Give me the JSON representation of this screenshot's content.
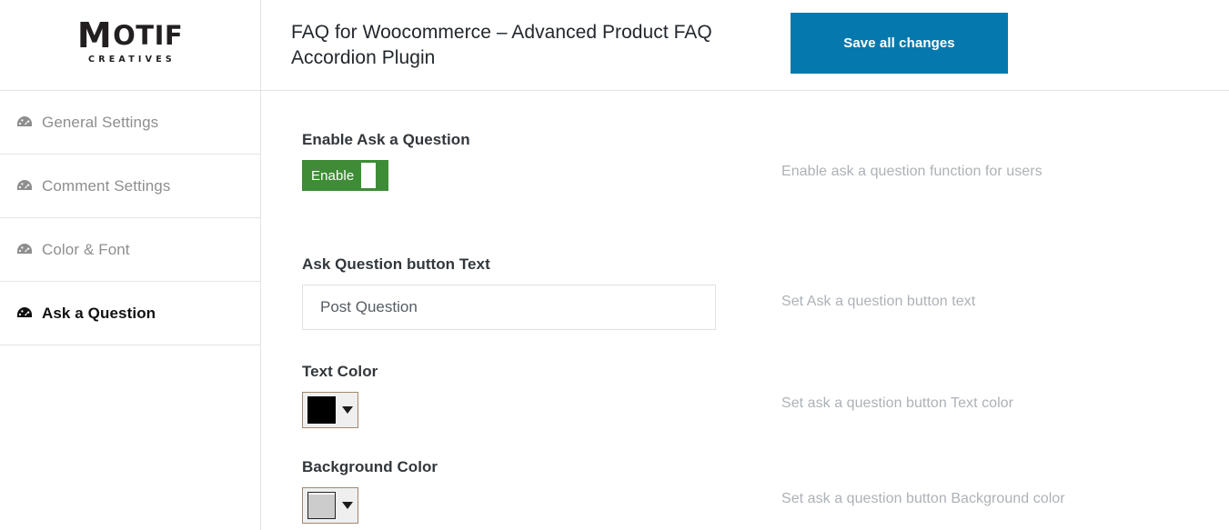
{
  "brand": {
    "name_big": "M",
    "name_rest": "OTIF",
    "tagline": "CREATIVES",
    "logo_icon": "motif-creatives-logo"
  },
  "sidebar": {
    "items": [
      {
        "label": "General Settings",
        "icon": "gauge-icon",
        "active": false
      },
      {
        "label": "Comment Settings",
        "icon": "gauge-icon",
        "active": false
      },
      {
        "label": "Color & Font",
        "icon": "gauge-icon",
        "active": false
      },
      {
        "label": "Ask a Question",
        "icon": "gauge-icon",
        "active": true
      }
    ]
  },
  "header": {
    "title": "FAQ for Woocommerce – Advanced Product FAQ Accordion Plugin",
    "save_label": "Save all changes",
    "save_color": "#0579ad"
  },
  "fields": {
    "enable": {
      "label": "Enable Ask a Question",
      "toggle_text": "Enable",
      "toggle_state": "on",
      "toggle_color": "#3e8c35",
      "help": "Enable ask a question function for users"
    },
    "button_text": {
      "label": "Ask Question button Text",
      "value": "Post Question",
      "placeholder": "Post Question",
      "help": "Set Ask a question button text"
    },
    "text_color": {
      "label": "Text Color",
      "value": "#000000",
      "help": "Set ask a question button Text color"
    },
    "background_color": {
      "label": "Background Color",
      "value": "#cccccc",
      "help": "Set ask a question button Background color"
    }
  }
}
